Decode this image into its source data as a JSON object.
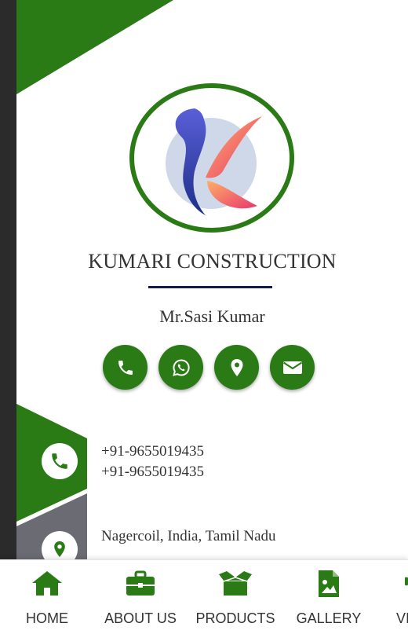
{
  "brand": {
    "company_name": "KUMARI CONSTRUCTION",
    "person_name": "Mr.Sasi Kumar",
    "accent_color": "#2a7a16",
    "logo_icon": "k-letter-logo-icon"
  },
  "actions": [
    {
      "name": "call",
      "icon": "phone-icon"
    },
    {
      "name": "whatsapp",
      "icon": "whatsapp-icon"
    },
    {
      "name": "location",
      "icon": "map-marker-icon"
    },
    {
      "name": "email",
      "icon": "envelope-icon"
    }
  ],
  "contact": {
    "phone_1": "+91-9655019435",
    "phone_2": "+91-9655019435",
    "address": "Nagercoil, India, Tamil Nadu"
  },
  "bottom_nav": {
    "items": [
      {
        "label": "HOME",
        "icon": "home-icon"
      },
      {
        "label": "ABOUT US",
        "icon": "briefcase-icon"
      },
      {
        "label": "PRODUCTS",
        "icon": "box-open-icon"
      },
      {
        "label": "GALLERY",
        "icon": "image-file-icon"
      },
      {
        "label": "VI",
        "icon": "video-icon"
      }
    ]
  }
}
